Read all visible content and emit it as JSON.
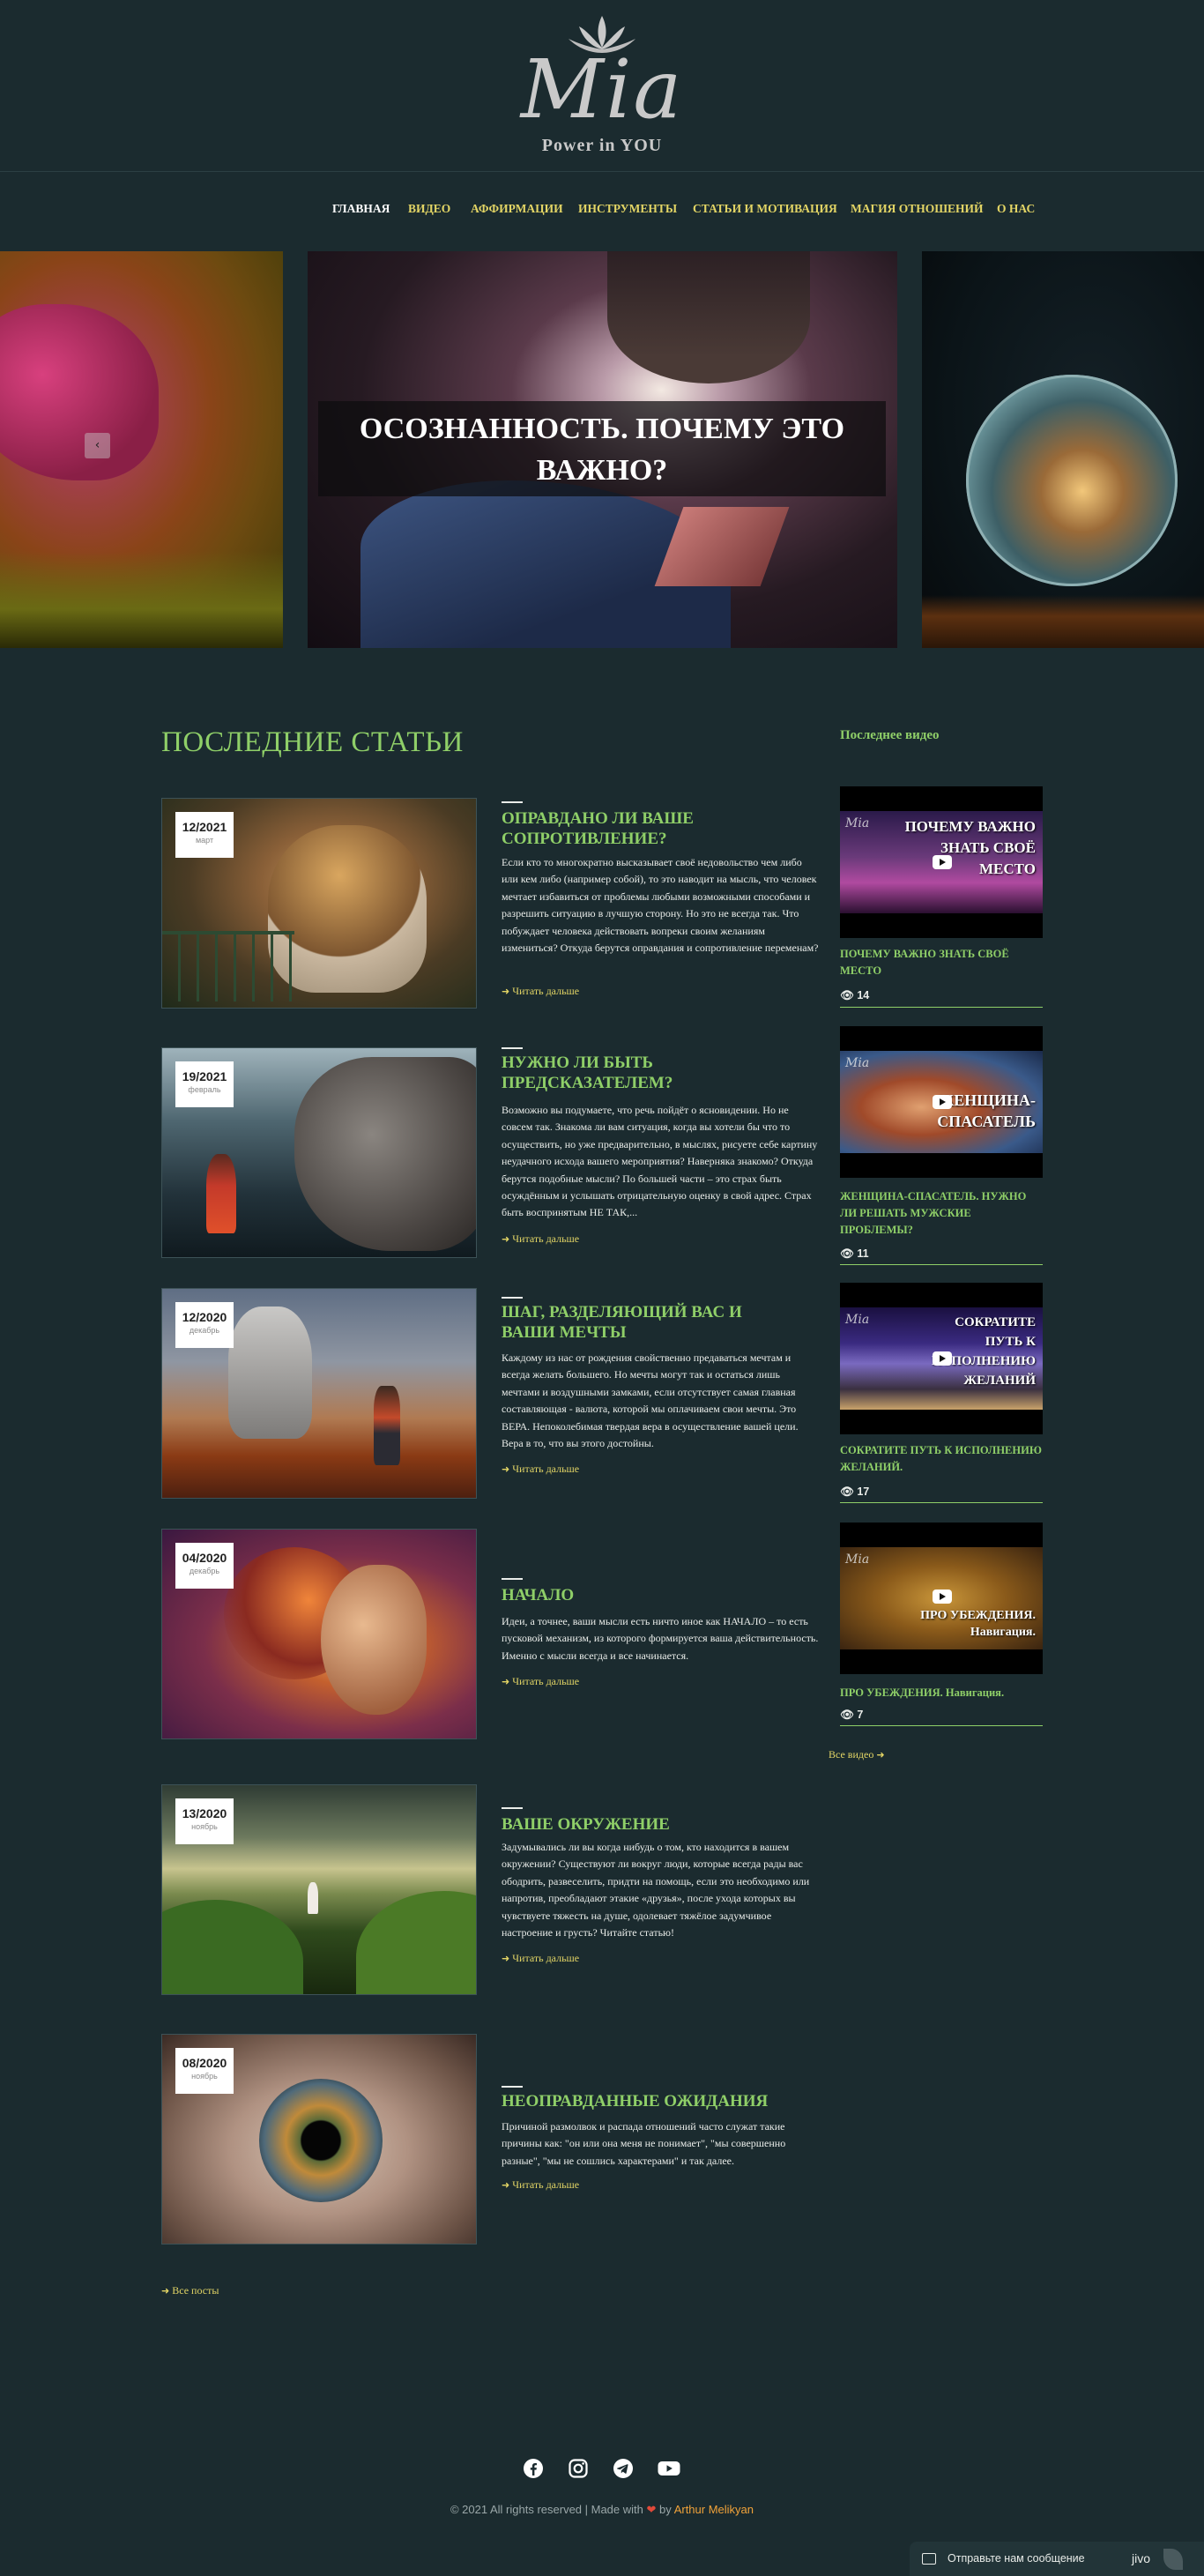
{
  "site": {
    "logo_script": "Mia",
    "logo_tagline": "Power in YOU"
  },
  "nav": {
    "items": [
      "ГЛАВНАЯ",
      "ВИДЕО",
      "АФФИРМАЦИИ",
      "ИНСТРУМЕНТЫ",
      "СТАТЬИ И МОТИВАЦИЯ",
      "МАГИЯ ОТНОШЕНИЙ",
      "О НАС"
    ],
    "active": "ГЛАВНАЯ"
  },
  "slider": {
    "caption": "ОСОЗНАННОСТЬ. ПОЧЕМУ ЭТО ВАЖНО?",
    "prev_icon": "chevron-left-icon"
  },
  "articles": {
    "section_title": "ПОСЛЕДНИЕ СТАТЬИ",
    "read_more": "Читать дальше",
    "all_posts": "Все посты",
    "items": [
      {
        "date": "12/2021",
        "month": "март",
        "title": "ОПРАВДАНО ЛИ ВАШЕ СОПРОТИВЛЕНИЕ?",
        "excerpt": "Если кто то многократно высказывает своё недовольство чем либо или кем либо (например собой), то это наводит на мысль, что человек мечтает избавиться от проблемы любыми возможными способами и разрешить ситуацию в лучшую сторону. Но это не всегда так. Что побуждает человека действовать вопреки своим желаниям измениться? Откуда берутся оправдания и сопротивление переменам?"
      },
      {
        "date": "19/2021",
        "month": "февраль",
        "title": "НУЖНО ЛИ БЫТЬ ПРЕДСКАЗАТЕЛЕМ?",
        "excerpt": "Возможно вы подумаете, что речь пойдёт о ясновидении. Но не совсем так. Знакома ли вам ситуация, когда вы хотели бы что то осуществить, но уже предварительно, в мыслях, рисуете себе картину неудачного исхода вашего мероприятия? Наверняка знакомо? Откуда берутся подобные мысли? По большей части – это страх быть осуждённым и услышать отрицательную оценку в свой адрес. Страх быть воспринятым НЕ ТАК,..."
      },
      {
        "date": "12/2020",
        "month": "декабрь",
        "title": "ШАГ, РАЗДЕЛЯЮЩИЙ ВАС И ВАШИ МЕЧТЫ",
        "excerpt": "Каждому из нас от рождения свойственно предаваться мечтам и всегда желать большего. Но мечты могут так и остаться лишь мечтами и воздушными замками, если отсутствует самая главная составляющая - валюта, которой мы оплачиваем свои мечты. Это ВЕРА. Непоколебимая твердая вера в осуществление вашей цели. Вера в то, что вы этого достойны."
      },
      {
        "date": "04/2020",
        "month": "декабрь",
        "title": "НАЧАЛО",
        "excerpt": "Идеи, а точнее, ваши мысли есть ничто иное как НАЧАЛО – то есть пусковой механизм, из которого формируется ваша действительность. Именно с мысли всегда и все начинается."
      },
      {
        "date": "13/2020",
        "month": "ноябрь",
        "title": "ВАШЕ ОКРУЖЕНИЕ",
        "excerpt": "Задумывались ли вы когда нибудь о том, кто находится в вашем окружении? Существуют ли вокруг люди, которые всегда рады вас ободрить, развеселить, придти на помощь, если это необходимо или напротив, преобладают этакие «друзья», после ухода которых вы чувствуете тяжесть на душе, одолевает тяжёлое задумчивое настроение и грусть? Читайте статью!"
      },
      {
        "date": "08/2020",
        "month": "ноябрь",
        "title": "НЕОПРАВДАННЫЕ ОЖИДАНИЯ",
        "excerpt": "Причиной размолвок и распада отношений часто служат такие причины как: \"он или она меня не понимает\", \"мы совершенно разные\", \"мы не сошлись характерами\" и так далее."
      }
    ]
  },
  "sidebar": {
    "title": "Последнее видео",
    "all_videos": "Все видео",
    "videos": [
      {
        "thumb_text": "ПОЧЕМУ ВАЖНО ЗНАТЬ СВОЁ МЕСТО",
        "caption": "ПОЧЕМУ ВАЖНО ЗНАТЬ СВОЁ МЕСТО",
        "views": "14"
      },
      {
        "thumb_text": "ЖЕНЩИНА-СПАСАТЕЛЬ",
        "caption": "ЖЕНЩИНА-СПАСАТЕЛЬ. НУЖНО ЛИ РЕШАТЬ МУЖСКИЕ ПРОБЛЕМЫ?",
        "views": "11"
      },
      {
        "thumb_text": "СОКРАТИТЕ ПУТЬ К ИСПОЛНЕНИЮ ЖЕЛАНИЙ",
        "caption": "СОКРАТИТЕ ПУТЬ К ИСПОЛНЕНИЮ ЖЕЛАНИЙ.",
        "views": "17"
      },
      {
        "thumb_text": "ПРО УБЕЖДЕНИЯ. Навигация.",
        "caption": "ПРО УБЕЖДЕНИЯ. Навигация.",
        "views": "7"
      }
    ]
  },
  "footer": {
    "social_icons": [
      "facebook-icon",
      "instagram-icon",
      "telegram-icon",
      "youtube-icon"
    ],
    "copyright_prefix": "© 2021 All rights reserved | Made with",
    "copyright_by": "by",
    "author": "Arthur Melikyan"
  },
  "chat": {
    "text": "Отправьте нам сообщение",
    "brand": "jivo"
  },
  "colors": {
    "background": "#1b2b2f",
    "accent_green": "#8fcf68",
    "accent_yellow": "#e3d565",
    "author_orange": "#f0a23a"
  }
}
